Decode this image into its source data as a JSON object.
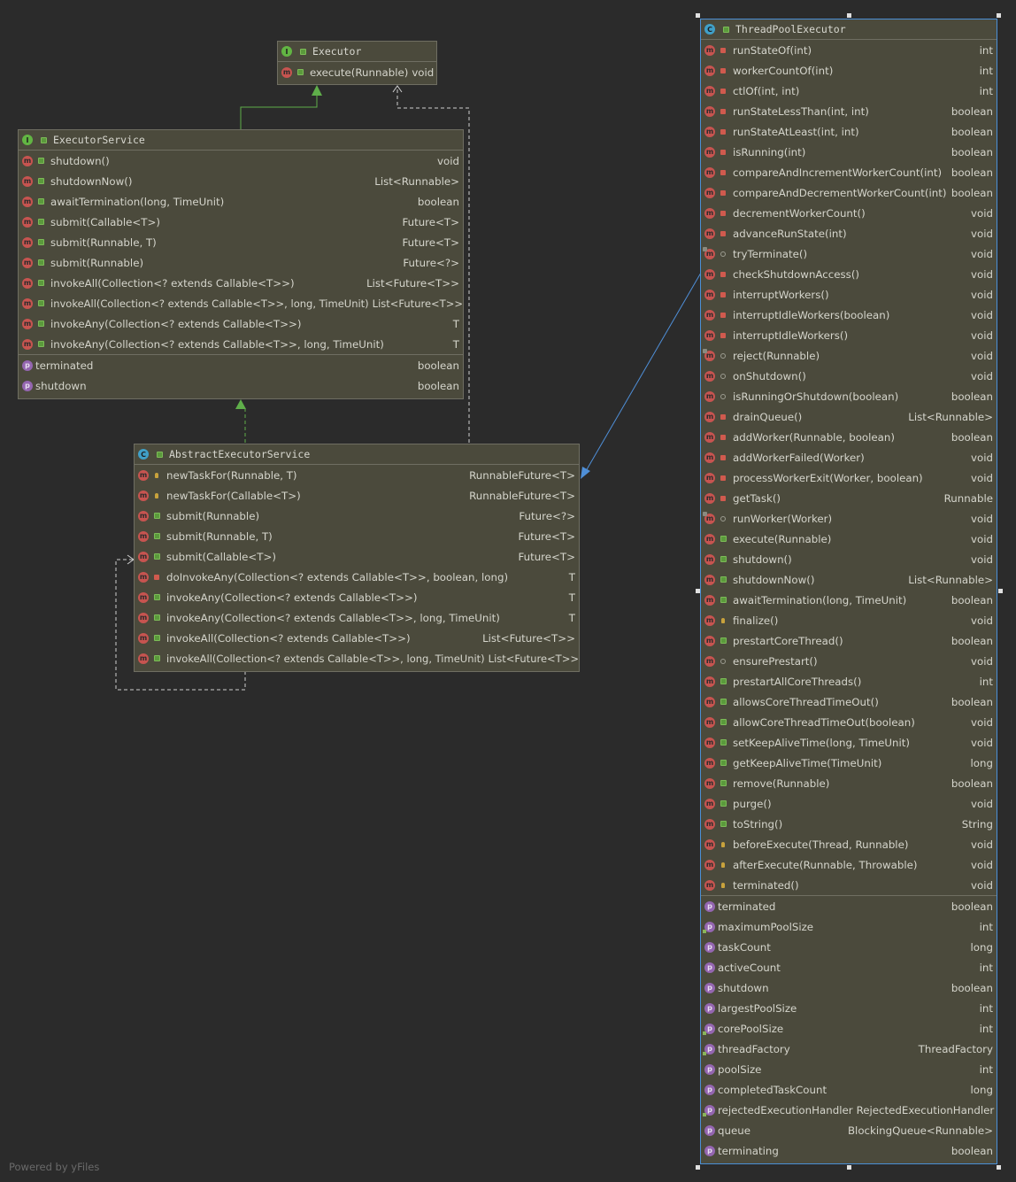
{
  "footer": {
    "powered_by": "Powered by yFiles"
  },
  "classes": {
    "executor": {
      "kind": "I",
      "name": "Executor",
      "methods": [
        {
          "vis": "pub",
          "name": "execute(Runnable)",
          "type": "void",
          "ov": false
        }
      ],
      "properties": []
    },
    "executor_service": {
      "kind": "I",
      "name": "ExecutorService",
      "methods": [
        {
          "vis": "pub",
          "name": "shutdown()",
          "type": "void",
          "ov": false
        },
        {
          "vis": "pub",
          "name": "shutdownNow()",
          "type": "List<Runnable>",
          "ov": false
        },
        {
          "vis": "pub",
          "name": "awaitTermination(long, TimeUnit)",
          "type": "boolean",
          "ov": false
        },
        {
          "vis": "pub",
          "name": "submit(Callable<T>)",
          "type": "Future<T>",
          "ov": false
        },
        {
          "vis": "pub",
          "name": "submit(Runnable, T)",
          "type": "Future<T>",
          "ov": false
        },
        {
          "vis": "pub",
          "name": "submit(Runnable)",
          "type": "Future<?>",
          "ov": false
        },
        {
          "vis": "pub",
          "name": "invokeAll(Collection<? extends Callable<T>>)",
          "type": "List<Future<T>>",
          "ov": false
        },
        {
          "vis": "pub",
          "name": "invokeAll(Collection<? extends Callable<T>>, long, TimeUnit)",
          "type": "List<Future<T>>",
          "ov": false
        },
        {
          "vis": "pub",
          "name": "invokeAny(Collection<? extends Callable<T>>)",
          "type": "T",
          "ov": false
        },
        {
          "vis": "pub",
          "name": "invokeAny(Collection<? extends Callable<T>>, long, TimeUnit)",
          "type": "T",
          "ov": false
        }
      ],
      "properties": [
        {
          "name": "terminated",
          "type": "boolean",
          "rw": false
        },
        {
          "name": "shutdown",
          "type": "boolean",
          "rw": false
        }
      ]
    },
    "abstract_executor_service": {
      "kind": "C",
      "name": "AbstractExecutorService",
      "methods": [
        {
          "vis": "prot",
          "name": "newTaskFor(Runnable, T)",
          "type": "RunnableFuture<T>",
          "ov": false
        },
        {
          "vis": "prot",
          "name": "newTaskFor(Callable<T>)",
          "type": "RunnableFuture<T>",
          "ov": false
        },
        {
          "vis": "pub",
          "name": "submit(Runnable)",
          "type": "Future<?>",
          "ov": false
        },
        {
          "vis": "pub",
          "name": "submit(Runnable, T)",
          "type": "Future<T>",
          "ov": false
        },
        {
          "vis": "pub",
          "name": "submit(Callable<T>)",
          "type": "Future<T>",
          "ov": false
        },
        {
          "vis": "priv",
          "name": "doInvokeAny(Collection<? extends Callable<T>>, boolean, long)",
          "type": "T",
          "ov": false
        },
        {
          "vis": "pub",
          "name": "invokeAny(Collection<? extends Callable<T>>)",
          "type": "T",
          "ov": false
        },
        {
          "vis": "pub",
          "name": "invokeAny(Collection<? extends Callable<T>>, long, TimeUnit)",
          "type": "T",
          "ov": false
        },
        {
          "vis": "pub",
          "name": "invokeAll(Collection<? extends Callable<T>>)",
          "type": "List<Future<T>>",
          "ov": false
        },
        {
          "vis": "pub",
          "name": "invokeAll(Collection<? extends Callable<T>>, long, TimeUnit)",
          "type": "List<Future<T>>",
          "ov": false
        }
      ],
      "properties": []
    },
    "thread_pool_executor": {
      "kind": "C",
      "name": "ThreadPoolExecutor",
      "methods": [
        {
          "vis": "priv",
          "name": "runStateOf(int)",
          "type": "int",
          "ov": false
        },
        {
          "vis": "priv",
          "name": "workerCountOf(int)",
          "type": "int",
          "ov": false
        },
        {
          "vis": "priv",
          "name": "ctlOf(int, int)",
          "type": "int",
          "ov": false
        },
        {
          "vis": "priv",
          "name": "runStateLessThan(int, int)",
          "type": "boolean",
          "ov": false
        },
        {
          "vis": "priv",
          "name": "runStateAtLeast(int, int)",
          "type": "boolean",
          "ov": false
        },
        {
          "vis": "priv",
          "name": "isRunning(int)",
          "type": "boolean",
          "ov": false
        },
        {
          "vis": "priv",
          "name": "compareAndIncrementWorkerCount(int)",
          "type": "boolean",
          "ov": false
        },
        {
          "vis": "priv",
          "name": "compareAndDecrementWorkerCount(int)",
          "type": "boolean",
          "ov": false
        },
        {
          "vis": "priv",
          "name": "decrementWorkerCount()",
          "type": "void",
          "ov": false
        },
        {
          "vis": "priv",
          "name": "advanceRunState(int)",
          "type": "void",
          "ov": false
        },
        {
          "vis": "pkg",
          "name": "tryTerminate()",
          "type": "void",
          "ov": true
        },
        {
          "vis": "priv",
          "name": "checkShutdownAccess()",
          "type": "void",
          "ov": false
        },
        {
          "vis": "priv",
          "name": "interruptWorkers()",
          "type": "void",
          "ov": false
        },
        {
          "vis": "priv",
          "name": "interruptIdleWorkers(boolean)",
          "type": "void",
          "ov": false
        },
        {
          "vis": "priv",
          "name": "interruptIdleWorkers()",
          "type": "void",
          "ov": false
        },
        {
          "vis": "pkg",
          "name": "reject(Runnable)",
          "type": "void",
          "ov": true
        },
        {
          "vis": "pkg",
          "name": "onShutdown()",
          "type": "void",
          "ov": false
        },
        {
          "vis": "pkg",
          "name": "isRunningOrShutdown(boolean)",
          "type": "boolean",
          "ov": false
        },
        {
          "vis": "priv",
          "name": "drainQueue()",
          "type": "List<Runnable>",
          "ov": false
        },
        {
          "vis": "priv",
          "name": "addWorker(Runnable, boolean)",
          "type": "boolean",
          "ov": false
        },
        {
          "vis": "priv",
          "name": "addWorkerFailed(Worker)",
          "type": "void",
          "ov": false
        },
        {
          "vis": "priv",
          "name": "processWorkerExit(Worker, boolean)",
          "type": "void",
          "ov": false
        },
        {
          "vis": "priv",
          "name": "getTask()",
          "type": "Runnable",
          "ov": false
        },
        {
          "vis": "pkg",
          "name": "runWorker(Worker)",
          "type": "void",
          "ov": true
        },
        {
          "vis": "pub",
          "name": "execute(Runnable)",
          "type": "void",
          "ov": false
        },
        {
          "vis": "pub",
          "name": "shutdown()",
          "type": "void",
          "ov": false
        },
        {
          "vis": "pub",
          "name": "shutdownNow()",
          "type": "List<Runnable>",
          "ov": false
        },
        {
          "vis": "pub",
          "name": "awaitTermination(long, TimeUnit)",
          "type": "boolean",
          "ov": false
        },
        {
          "vis": "prot",
          "name": "finalize()",
          "type": "void",
          "ov": false
        },
        {
          "vis": "pub",
          "name": "prestartCoreThread()",
          "type": "boolean",
          "ov": false
        },
        {
          "vis": "pkg",
          "name": "ensurePrestart()",
          "type": "void",
          "ov": false
        },
        {
          "vis": "pub",
          "name": "prestartAllCoreThreads()",
          "type": "int",
          "ov": false
        },
        {
          "vis": "pub",
          "name": "allowsCoreThreadTimeOut()",
          "type": "boolean",
          "ov": false
        },
        {
          "vis": "pub",
          "name": "allowCoreThreadTimeOut(boolean)",
          "type": "void",
          "ov": false
        },
        {
          "vis": "pub",
          "name": "setKeepAliveTime(long, TimeUnit)",
          "type": "void",
          "ov": false
        },
        {
          "vis": "pub",
          "name": "getKeepAliveTime(TimeUnit)",
          "type": "long",
          "ov": false
        },
        {
          "vis": "pub",
          "name": "remove(Runnable)",
          "type": "boolean",
          "ov": false
        },
        {
          "vis": "pub",
          "name": "purge()",
          "type": "void",
          "ov": false
        },
        {
          "vis": "pub",
          "name": "toString()",
          "type": "String",
          "ov": false
        },
        {
          "vis": "prot",
          "name": "beforeExecute(Thread, Runnable)",
          "type": "void",
          "ov": false
        },
        {
          "vis": "prot",
          "name": "afterExecute(Runnable, Throwable)",
          "type": "void",
          "ov": false
        },
        {
          "vis": "prot",
          "name": "terminated()",
          "type": "void",
          "ov": false
        }
      ],
      "properties": [
        {
          "name": "terminated",
          "type": "boolean",
          "rw": false
        },
        {
          "name": "maximumPoolSize",
          "type": "int",
          "rw": true
        },
        {
          "name": "taskCount",
          "type": "long",
          "rw": false
        },
        {
          "name": "activeCount",
          "type": "int",
          "rw": false
        },
        {
          "name": "shutdown",
          "type": "boolean",
          "rw": false
        },
        {
          "name": "largestPoolSize",
          "type": "int",
          "rw": false
        },
        {
          "name": "corePoolSize",
          "type": "int",
          "rw": true
        },
        {
          "name": "threadFactory",
          "type": "ThreadFactory",
          "rw": true
        },
        {
          "name": "poolSize",
          "type": "int",
          "rw": false
        },
        {
          "name": "completedTaskCount",
          "type": "long",
          "rw": false
        },
        {
          "name": "rejectedExecutionHandler",
          "type": "RejectedExecutionHandler",
          "rw": true
        },
        {
          "name": "queue",
          "type": "BlockingQueue<Runnable>",
          "rw": false
        },
        {
          "name": "terminating",
          "type": "boolean",
          "rw": false
        }
      ]
    }
  }
}
